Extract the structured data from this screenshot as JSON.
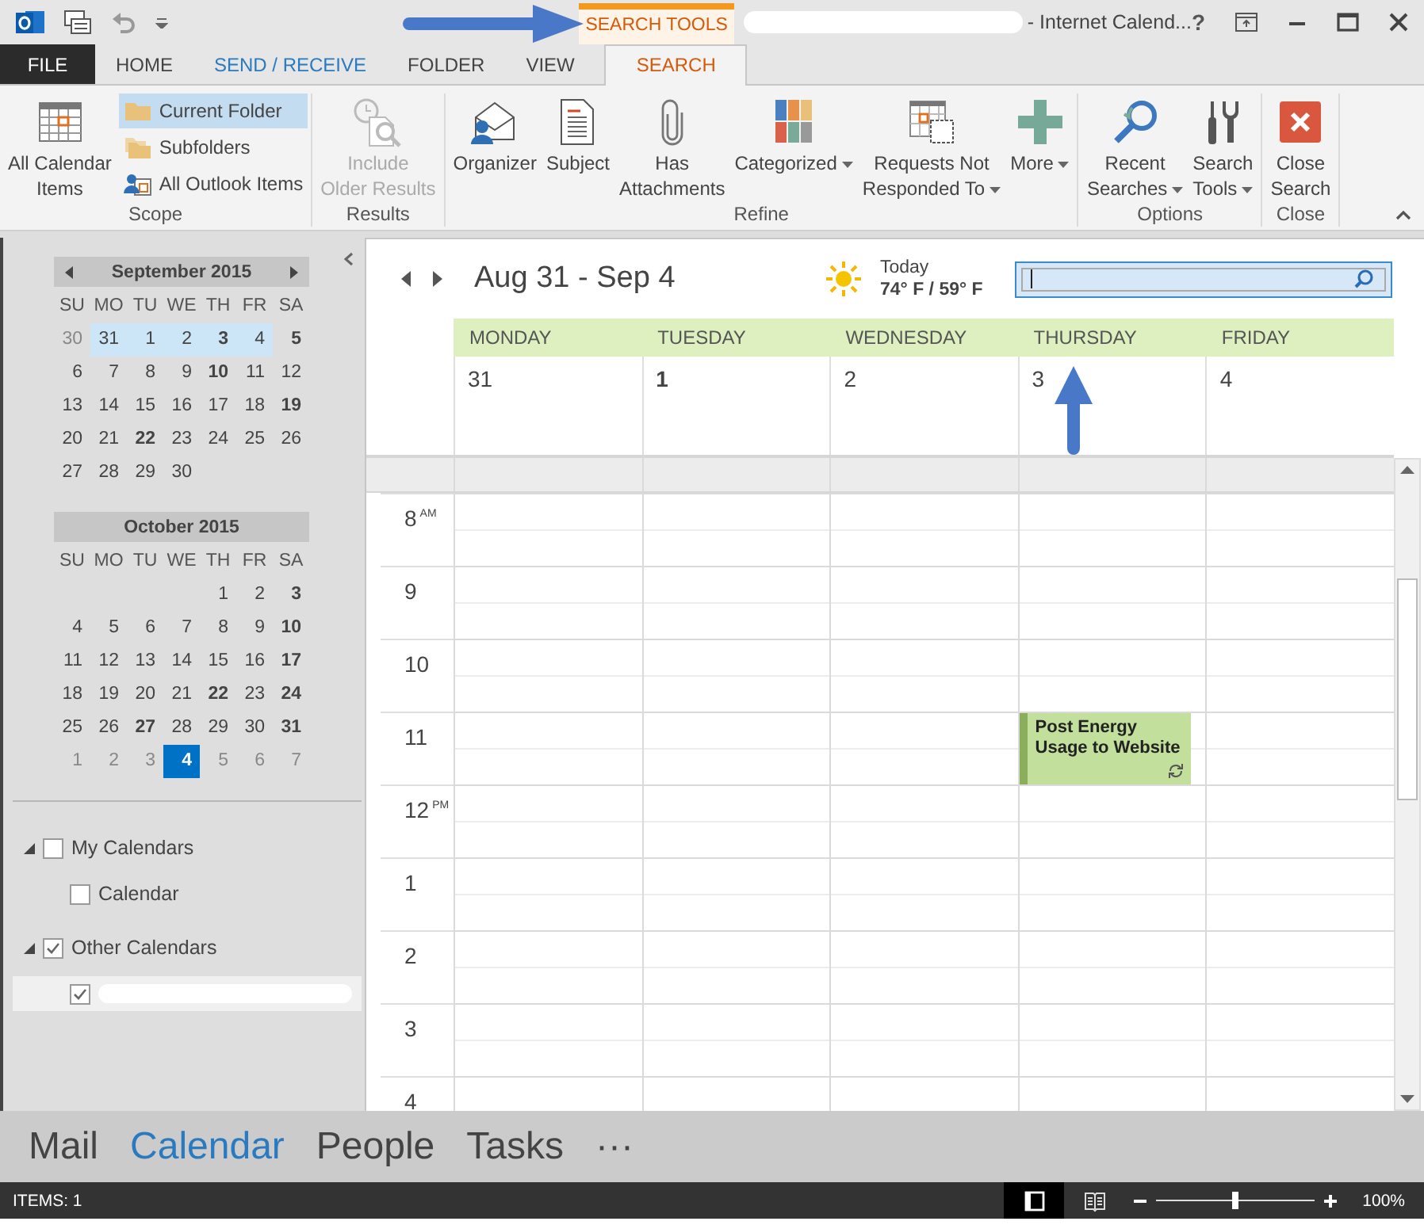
{
  "window": {
    "title": "- Internet Calend...",
    "help": "?"
  },
  "contextual_tab": {
    "label": "SEARCH TOOLS"
  },
  "tabs": [
    {
      "label": "FILE",
      "kind": "file",
      "selected": false
    },
    {
      "label": "HOME",
      "kind": "plain",
      "selected": false
    },
    {
      "label": "SEND / RECEIVE",
      "kind": "accent",
      "selected": false
    },
    {
      "label": "FOLDER",
      "kind": "plain",
      "selected": false
    },
    {
      "label": "VIEW",
      "kind": "plain",
      "selected": false
    },
    {
      "label": "SEARCH",
      "kind": "contextual",
      "selected": true
    }
  ],
  "ribbon": {
    "groups": [
      {
        "label": "Scope",
        "buttons": [
          {
            "kind": "large",
            "label": "All Calendar\nItems",
            "dropdown": false,
            "disabled": false
          },
          {
            "kind": "small",
            "label": "Current Folder",
            "selected": true
          },
          {
            "kind": "small",
            "label": "Subfolders",
            "selected": false
          },
          {
            "kind": "small",
            "label": "All Outlook Items",
            "selected": false
          }
        ]
      },
      {
        "label": "Results",
        "buttons": [
          {
            "kind": "large",
            "label": "Include\nOlder Results",
            "dropdown": false,
            "disabled": true
          }
        ]
      },
      {
        "label": "Refine",
        "buttons": [
          {
            "kind": "large",
            "label": "Organizer",
            "dropdown": false,
            "disabled": false
          },
          {
            "kind": "large",
            "label": "Subject",
            "dropdown": false,
            "disabled": false
          },
          {
            "kind": "large",
            "label": "Has\nAttachments",
            "dropdown": false,
            "disabled": false
          },
          {
            "kind": "large",
            "label": "Categorized",
            "dropdown": true,
            "disabled": false
          },
          {
            "kind": "large",
            "label": "Requests Not\nResponded To",
            "dropdown": true,
            "disabled": false
          },
          {
            "kind": "large",
            "label": "More",
            "dropdown": true,
            "disabled": false
          }
        ]
      },
      {
        "label": "Options",
        "buttons": [
          {
            "kind": "large",
            "label": "Recent\nSearches",
            "dropdown": true,
            "disabled": false
          },
          {
            "kind": "large",
            "label": "Search\nTools",
            "dropdown": true,
            "disabled": false
          }
        ]
      },
      {
        "label": "Close",
        "buttons": [
          {
            "kind": "large",
            "label": "Close\nSearch",
            "dropdown": false,
            "disabled": false
          }
        ]
      }
    ]
  },
  "mini_calendars": [
    {
      "title": "September 2015",
      "arrows": true,
      "weekdays": [
        "SU",
        "MO",
        "TU",
        "WE",
        "TH",
        "FR",
        "SA"
      ],
      "weeks": [
        [
          {
            "day": "30",
            "kind": "muted",
            "selected": false
          },
          {
            "day": "31",
            "kind": "normal",
            "selected": true
          },
          {
            "day": "1",
            "kind": "normal",
            "selected": true
          },
          {
            "day": "2",
            "kind": "normal",
            "selected": true
          },
          {
            "day": "3",
            "kind": "bold",
            "selected": true
          },
          {
            "day": "4",
            "kind": "normal",
            "selected": true
          },
          {
            "day": "5",
            "kind": "bold",
            "selected": false
          }
        ],
        [
          {
            "day": "6",
            "kind": "normal",
            "selected": false
          },
          {
            "day": "7",
            "kind": "normal",
            "selected": false
          },
          {
            "day": "8",
            "kind": "normal",
            "selected": false
          },
          {
            "day": "9",
            "kind": "normal",
            "selected": false
          },
          {
            "day": "10",
            "kind": "bold",
            "selected": false
          },
          {
            "day": "11",
            "kind": "normal",
            "selected": false
          },
          {
            "day": "12",
            "kind": "normal",
            "selected": false
          }
        ],
        [
          {
            "day": "13",
            "kind": "normal",
            "selected": false
          },
          {
            "day": "14",
            "kind": "normal",
            "selected": false
          },
          {
            "day": "15",
            "kind": "normal",
            "selected": false
          },
          {
            "day": "16",
            "kind": "normal",
            "selected": false
          },
          {
            "day": "17",
            "kind": "normal",
            "selected": false
          },
          {
            "day": "18",
            "kind": "normal",
            "selected": false
          },
          {
            "day": "19",
            "kind": "bold",
            "selected": false
          }
        ],
        [
          {
            "day": "20",
            "kind": "normal",
            "selected": false
          },
          {
            "day": "21",
            "kind": "normal",
            "selected": false
          },
          {
            "day": "22",
            "kind": "bold",
            "selected": false
          },
          {
            "day": "23",
            "kind": "normal",
            "selected": false
          },
          {
            "day": "24",
            "kind": "normal",
            "selected": false
          },
          {
            "day": "25",
            "kind": "normal",
            "selected": false
          },
          {
            "day": "26",
            "kind": "normal",
            "selected": false
          }
        ],
        [
          {
            "day": "27",
            "kind": "normal",
            "selected": false
          },
          {
            "day": "28",
            "kind": "normal",
            "selected": false
          },
          {
            "day": "29",
            "kind": "normal",
            "selected": false
          },
          {
            "day": "30",
            "kind": "normal",
            "selected": false
          }
        ]
      ]
    },
    {
      "title": "October 2015",
      "arrows": false,
      "weekdays": [
        "SU",
        "MO",
        "TU",
        "WE",
        "TH",
        "FR",
        "SA"
      ],
      "weeks": [
        [
          {
            "kind": "blank"
          },
          {
            "kind": "blank"
          },
          {
            "kind": "blank"
          },
          {
            "kind": "blank"
          },
          {
            "day": "1",
            "kind": "normal",
            "selected": false
          },
          {
            "day": "2",
            "kind": "normal",
            "selected": false
          },
          {
            "day": "3",
            "kind": "bold",
            "selected": false
          }
        ],
        [
          {
            "day": "4",
            "kind": "normal",
            "selected": false
          },
          {
            "day": "5",
            "kind": "normal",
            "selected": false
          },
          {
            "day": "6",
            "kind": "normal",
            "selected": false
          },
          {
            "day": "7",
            "kind": "normal",
            "selected": false
          },
          {
            "day": "8",
            "kind": "normal",
            "selected": false
          },
          {
            "day": "9",
            "kind": "normal",
            "selected": false
          },
          {
            "day": "10",
            "kind": "bold",
            "selected": false
          }
        ],
        [
          {
            "day": "11",
            "kind": "normal",
            "selected": false
          },
          {
            "day": "12",
            "kind": "normal",
            "selected": false
          },
          {
            "day": "13",
            "kind": "normal",
            "selected": false
          },
          {
            "day": "14",
            "kind": "normal",
            "selected": false
          },
          {
            "day": "15",
            "kind": "normal",
            "selected": false
          },
          {
            "day": "16",
            "kind": "normal",
            "selected": false
          },
          {
            "day": "17",
            "kind": "bold",
            "selected": false
          }
        ],
        [
          {
            "day": "18",
            "kind": "normal",
            "selected": false
          },
          {
            "day": "19",
            "kind": "normal",
            "selected": false
          },
          {
            "day": "20",
            "kind": "normal",
            "selected": false
          },
          {
            "day": "21",
            "kind": "normal",
            "selected": false
          },
          {
            "day": "22",
            "kind": "bold",
            "selected": false
          },
          {
            "day": "23",
            "kind": "normal",
            "selected": false
          },
          {
            "day": "24",
            "kind": "bold",
            "selected": false
          }
        ],
        [
          {
            "day": "25",
            "kind": "normal",
            "selected": false
          },
          {
            "day": "26",
            "kind": "normal",
            "selected": false
          },
          {
            "day": "27",
            "kind": "bold",
            "selected": false
          },
          {
            "day": "28",
            "kind": "normal",
            "selected": false
          },
          {
            "day": "29",
            "kind": "normal",
            "selected": false
          },
          {
            "day": "30",
            "kind": "normal",
            "selected": false
          },
          {
            "day": "31",
            "kind": "bold",
            "selected": false
          }
        ],
        [
          {
            "day": "1",
            "kind": "muted",
            "selected": false
          },
          {
            "day": "2",
            "kind": "muted",
            "selected": false
          },
          {
            "day": "3",
            "kind": "muted",
            "selected": false
          },
          {
            "day": "4",
            "kind": "today",
            "selected": false
          },
          {
            "day": "5",
            "kind": "muted",
            "selected": false
          },
          {
            "day": "6",
            "kind": "muted",
            "selected": false
          },
          {
            "day": "7",
            "kind": "muted",
            "selected": false
          }
        ]
      ]
    }
  ],
  "folders": [
    {
      "label": "My Calendars",
      "expanded": true,
      "checked": false,
      "selected": false,
      "children": [
        {
          "label": "Calendar",
          "checked": false,
          "selected": false
        }
      ]
    },
    {
      "label": "Other Calendars",
      "expanded": true,
      "checked": true,
      "selected": false,
      "children": [
        {
          "checked": true,
          "selected": true
        }
      ]
    }
  ],
  "week_view": {
    "range": "Aug 31 - Sep 4",
    "weather": {
      "label": "Today",
      "temps": "74° F / 59° F"
    },
    "days": [
      {
        "name": "MONDAY",
        "date": "31",
        "bold": false
      },
      {
        "name": "TUESDAY",
        "date": "1",
        "bold": true
      },
      {
        "name": "WEDNESDAY",
        "date": "2",
        "bold": false
      },
      {
        "name": "THURSDAY",
        "date": "3",
        "bold": false
      },
      {
        "name": "FRIDAY",
        "date": "4",
        "bold": false
      }
    ],
    "hours": [
      {
        "hour": "8",
        "suffix": "AM"
      },
      {
        "hour": "9"
      },
      {
        "hour": "10"
      },
      {
        "hour": "11",
        "slots": [
          {
            "kind": "empty"
          },
          {
            "kind": "empty"
          },
          {
            "kind": "empty"
          },
          {
            "kind": "event",
            "title": "Post Energy Usage to Website",
            "recurring": true
          },
          {
            "kind": "empty"
          }
        ]
      },
      {
        "hour": "12",
        "suffix": "PM"
      },
      {
        "hour": "1"
      },
      {
        "hour": "2"
      },
      {
        "hour": "3"
      },
      {
        "hour": "4"
      }
    ]
  },
  "navigation": [
    {
      "label": "Mail",
      "selected": false
    },
    {
      "label": "Calendar",
      "selected": true
    },
    {
      "label": "People",
      "selected": false
    },
    {
      "label": "Tasks",
      "selected": false
    },
    {
      "label": "···",
      "selected": false
    }
  ],
  "status_bar": {
    "items": "ITEMS: 1",
    "views": [
      {
        "selected": true
      },
      {
        "selected": false
      }
    ],
    "zoom": {
      "level": 0.5,
      "reading": "100%"
    }
  }
}
